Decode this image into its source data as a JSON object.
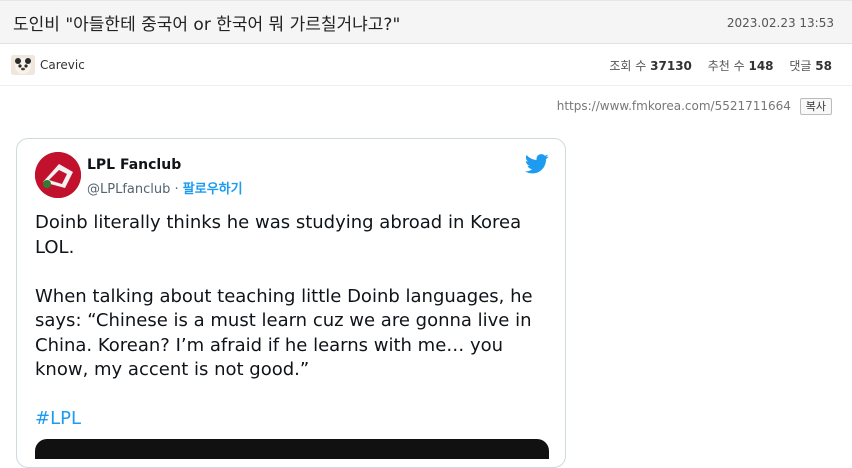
{
  "post": {
    "title": "도인비 \"아들한테 중국어 or 한국어 뭐 가르칠거냐고?\"",
    "date": "2023.02.23  13:53",
    "author": "Carevic",
    "views_label": "조회 수",
    "views": "37130",
    "recommend_label": "추천 수",
    "recommend": "148",
    "comments_label": "댓글",
    "comments": "58",
    "url": "https://www.fmkorea.com/5521711664",
    "copy_label": "복사"
  },
  "tweet": {
    "name": "LPL Fanclub",
    "handle": "@LPLfanclub",
    "separator": "·",
    "follow": "팔로우하기",
    "paragraph1": "Doinb literally thinks he was studying abroad in Korea LOL.",
    "paragraph2": "When talking about teaching little Doinb languages, he says: “Chinese is a must learn cuz we are gonna live in China. Korean? I’m afraid if he learns with me… you know, my accent is not good.”",
    "hashtag": "#LPL",
    "accent_color": "#1d9bf0"
  },
  "icons": {
    "bird": "twitter-bird-icon",
    "avatar": "user-avatar-icon"
  }
}
